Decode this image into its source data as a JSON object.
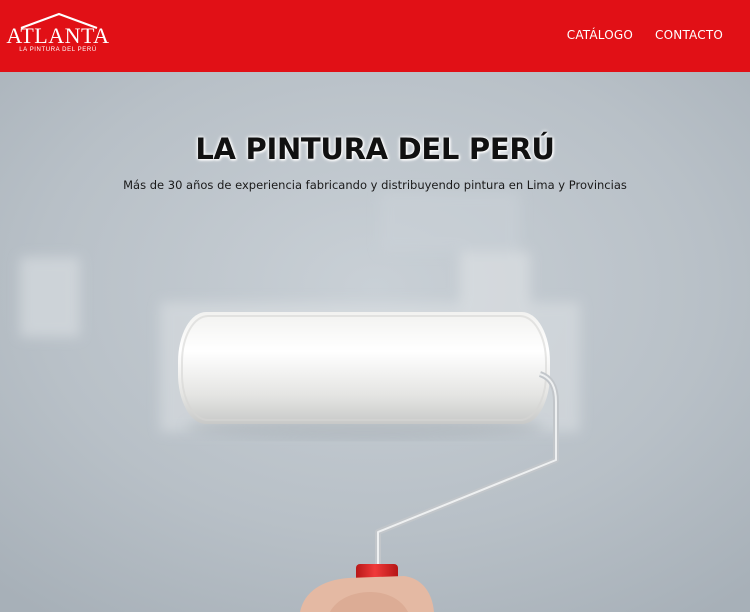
{
  "header": {
    "logo": {
      "name": "ATLANTA",
      "tagline": "LA PINTURA DEL PERÚ"
    },
    "nav": [
      {
        "label": "CATÁLOGO"
      },
      {
        "label": "CONTACTO"
      }
    ]
  },
  "hero": {
    "title": "LA PINTURA DEL PERÚ",
    "subtitle": "Más de 30 años de experiencia fabricando y distribuyendo pintura en Lima y Provincias",
    "image": "paint-roller-on-wall"
  },
  "colors": {
    "brand_red": "#e11016",
    "wall_gray": "#b9c1c8",
    "roller_handle": "#e52a2a"
  }
}
